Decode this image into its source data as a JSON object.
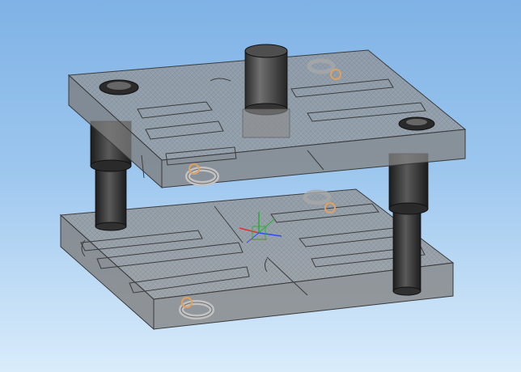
{
  "viewport": {
    "background_top": "#7fb2e6",
    "background_bottom": "#d9ecfb"
  },
  "model": {
    "plate_face_color": "#8c8c8c",
    "plate_edge_color": "#3a3a3a",
    "post_color": "#2c2c2c",
    "eyebolt_color": "#b8b8b8",
    "eyebolt_thread_color": "#e0a060",
    "triad_x_color": "#e53030",
    "triad_y_color": "#22b030",
    "triad_z_color": "#2a4cff"
  },
  "components": [
    {
      "name": "upper-die-plate",
      "icon": "plate-icon"
    },
    {
      "name": "lower-die-plate",
      "icon": "plate-icon"
    },
    {
      "name": "guide-post-left",
      "icon": "cylinder-icon"
    },
    {
      "name": "guide-post-right",
      "icon": "cylinder-icon"
    },
    {
      "name": "punch-shank",
      "icon": "cylinder-icon"
    },
    {
      "name": "eye-bolt",
      "icon": "ring-icon"
    },
    {
      "name": "coordinate-triad",
      "icon": "axes-icon"
    }
  ]
}
